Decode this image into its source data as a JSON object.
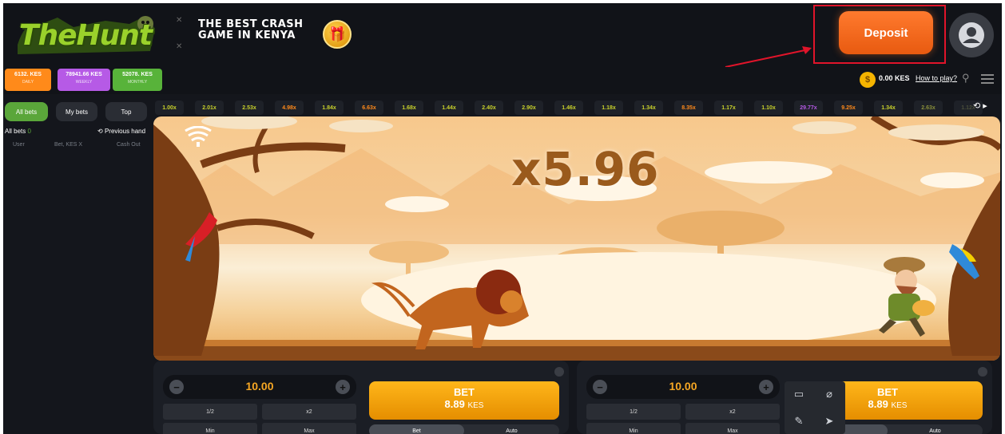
{
  "header": {
    "logo_text": "TheHunt",
    "tagline_line1": "THE BEST CRASH",
    "tagline_line2": "GAME IN KENYA",
    "deposit_label": "Deposit"
  },
  "jackpots": [
    {
      "amount": "6132.",
      "currency": "KES",
      "period": "DAILY"
    },
    {
      "amount": "78941.66",
      "currency": "KES",
      "period": "WEEKLY"
    },
    {
      "amount": "52078.",
      "currency": "KES",
      "period": "MONTHLY"
    }
  ],
  "account": {
    "balance": "0.00 KES",
    "how_to_play": "How to play?"
  },
  "sidebar": {
    "tabs": [
      "All bets",
      "My bets",
      "Top"
    ],
    "all_bets_label": "All bets",
    "all_bets_count": "0",
    "previous_hand": "Previous hand",
    "columns": [
      "User",
      "Bet, KES X",
      "Cash Out"
    ]
  },
  "history": [
    {
      "value": "1.00x",
      "color": "#c9d12b"
    },
    {
      "value": "2.01x",
      "color": "#c9d12b"
    },
    {
      "value": "2.53x",
      "color": "#c9d12b"
    },
    {
      "value": "4.98x",
      "color": "#ff8a1a"
    },
    {
      "value": "1.84x",
      "color": "#c9d12b"
    },
    {
      "value": "6.63x",
      "color": "#ff8a1a"
    },
    {
      "value": "1.68x",
      "color": "#c9d12b"
    },
    {
      "value": "1.44x",
      "color": "#c9d12b"
    },
    {
      "value": "2.40x",
      "color": "#c9d12b"
    },
    {
      "value": "2.90x",
      "color": "#c9d12b"
    },
    {
      "value": "1.46x",
      "color": "#c9d12b"
    },
    {
      "value": "1.18x",
      "color": "#c9d12b"
    },
    {
      "value": "1.34x",
      "color": "#c9d12b"
    },
    {
      "value": "8.35x",
      "color": "#ff8a1a"
    },
    {
      "value": "1.17x",
      "color": "#c9d12b"
    },
    {
      "value": "1.10x",
      "color": "#c9d12b"
    },
    {
      "value": "29.77x",
      "color": "#b65ae6"
    },
    {
      "value": "9.25x",
      "color": "#ff8a1a"
    },
    {
      "value": "1.34x",
      "color": "#c9d12b"
    },
    {
      "value": "2.63x",
      "color": "#8a8f3a"
    },
    {
      "value": "1.12x",
      "color": "#4a4e3a"
    }
  ],
  "game": {
    "multiplier": "x5.96"
  },
  "bet_panels": [
    {
      "amount": "10.00",
      "half": "1/2",
      "double": "x2",
      "min": "Min",
      "max": "Max",
      "bet_label": "BET",
      "bet_amount": "8.89",
      "bet_currency": "KES",
      "mode_bet": "Bet",
      "mode_auto": "Auto"
    },
    {
      "amount": "10.00",
      "half": "1/2",
      "double": "x2",
      "min": "Min",
      "max": "Max",
      "bet_label": "BET",
      "bet_amount": "8.89",
      "bet_currency": "KES",
      "mode_bet": "Bet",
      "mode_auto": "Auto"
    }
  ],
  "colors": {
    "deposit": "#ff6a1f",
    "accent_green": "#5aa63a",
    "bet_orange": "#ffb61a",
    "highlight_red": "#e0142a"
  }
}
